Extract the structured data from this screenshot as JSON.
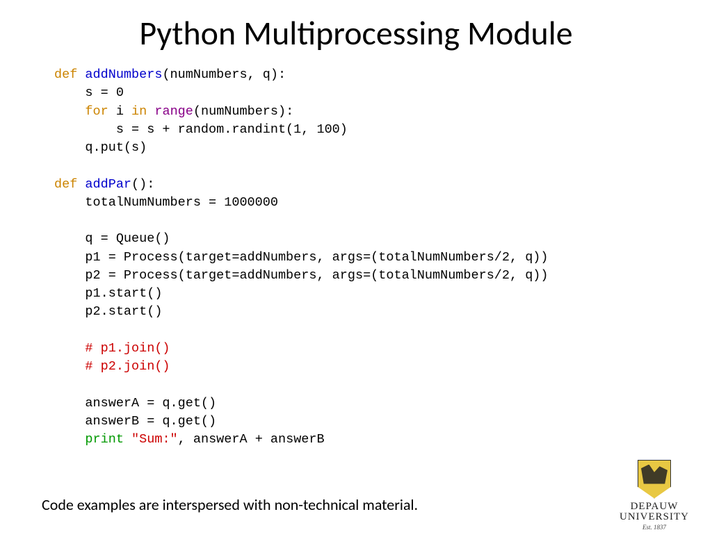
{
  "title": "Python Multiprocessing Module",
  "code": {
    "l1": {
      "def": "def",
      "fn": "addNumbers",
      "rest": "(numNumbers, q):"
    },
    "l2": "    s = 0",
    "l3": {
      "for": "for",
      "var": " i ",
      "in": "in",
      "sp": " ",
      "range": "range",
      "rest": "(numNumbers):"
    },
    "l4": "        s = s + random.randint(1, 100)",
    "l5": "    q.put(s)",
    "l6": "",
    "l7": {
      "def": "def",
      "fn": "addPar",
      "rest": "():"
    },
    "l8": "    totalNumNumbers = 1000000",
    "l9": "",
    "l10": "    q = Queue()",
    "l11": "    p1 = Process(target=addNumbers, args=(totalNumNumbers/2, q))",
    "l12": "    p2 = Process(target=addNumbers, args=(totalNumNumbers/2, q))",
    "l13": "    p1.start()",
    "l14": "    p2.start()",
    "l15": "",
    "l16": "    # p1.join()",
    "l17": "    # p2.join()",
    "l18": "",
    "l19": "    answerA = q.get()",
    "l20": "    answerB = q.get()",
    "l21": {
      "indent": "    ",
      "print": "print",
      "sp": " ",
      "str": "\"Sum:\"",
      "rest": ", answerA + answerB"
    }
  },
  "footer_note": "Code examples are interspersed with non-technical material.",
  "logo": {
    "line1": "DEPAUW",
    "line2": "UNIVERSITY",
    "est": "Est. 1837"
  }
}
